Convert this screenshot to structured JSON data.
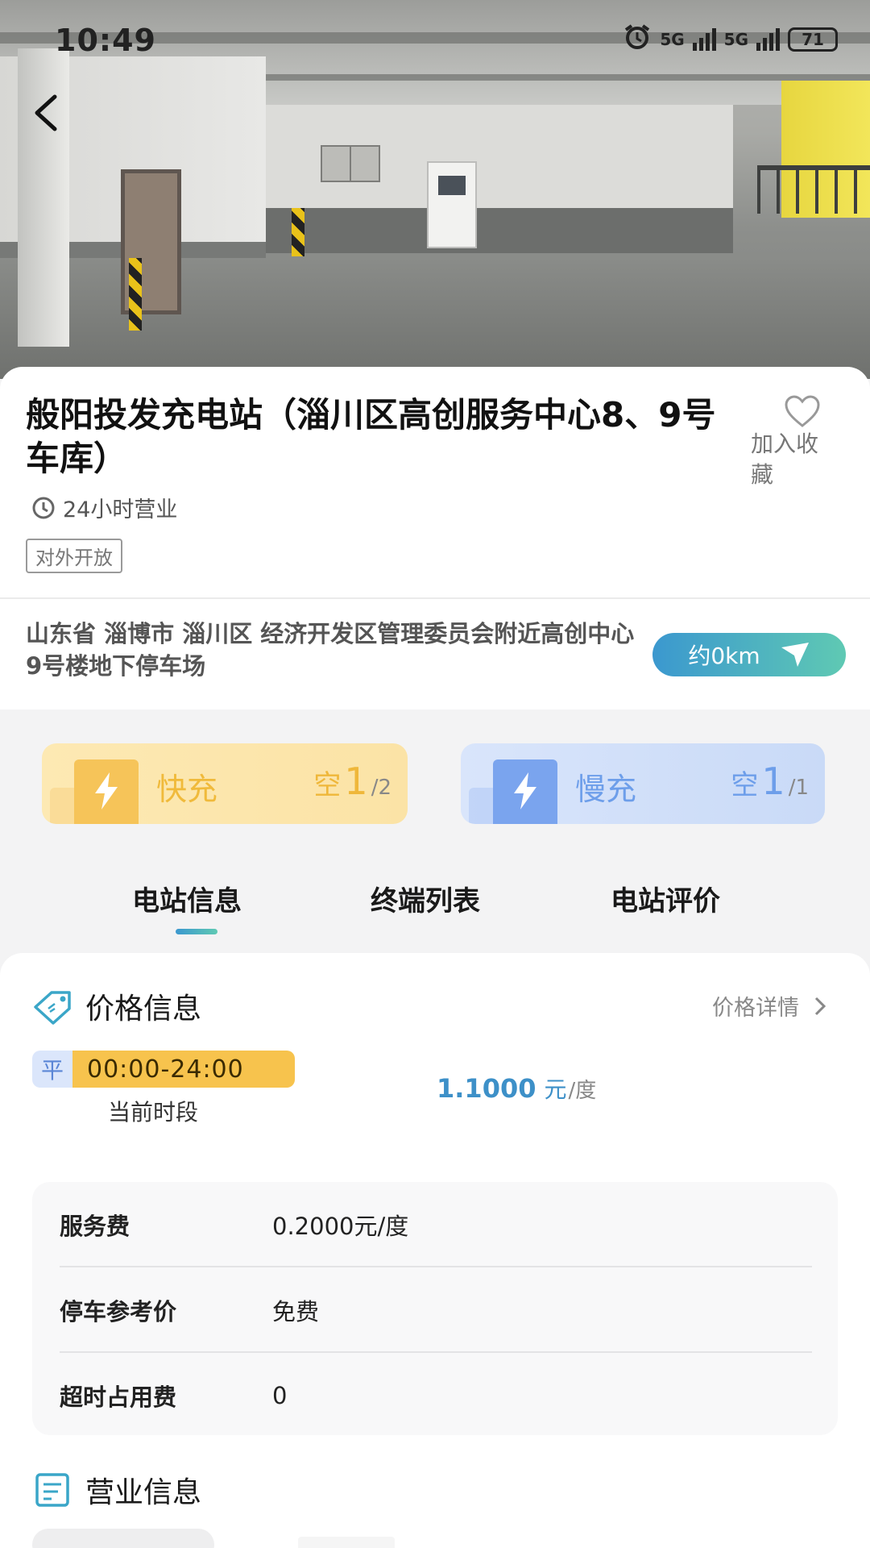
{
  "status_bar": {
    "time": "10:49",
    "network_1": "5G",
    "network_2": "5G",
    "battery": "71"
  },
  "station": {
    "name": "般阳投发充电站（淄川区高创服务中心8、9号车库）",
    "favorite_label": "加入收藏",
    "hours": "24小时营业",
    "access_tag": "对外开放",
    "address": "山东省 淄博市 淄川区 经济开发区管理委员会附近高创中心9号楼地下停车场",
    "distance": "约0km"
  },
  "chargers": {
    "fast": {
      "label": "快充",
      "free_prefix": "空",
      "available": "1",
      "total": "/2"
    },
    "slow": {
      "label": "慢充",
      "free_prefix": "空",
      "available": "1",
      "total": "/1"
    }
  },
  "tabs": [
    "电站信息",
    "终端列表",
    "电站评价"
  ],
  "active_tab": 0,
  "price": {
    "section_title": "价格信息",
    "detail_link": "价格详情",
    "period_badge": "平",
    "period_range": "00:00-24:00",
    "period_label": "当前时段",
    "value": "1.1000",
    "currency": "元",
    "per_unit": "/度",
    "fees": [
      {
        "label": "服务费",
        "value": "0.2000元/度"
      },
      {
        "label": "停车参考价",
        "value": "免费"
      },
      {
        "label": "超时占用费",
        "value": "0"
      }
    ]
  },
  "business": {
    "section_title": "营业信息"
  },
  "colors": {
    "accent_start": "#3b98cf",
    "accent_end": "#5fc9b3",
    "fast": "#f0ba3b",
    "slow": "#6d9eea"
  }
}
